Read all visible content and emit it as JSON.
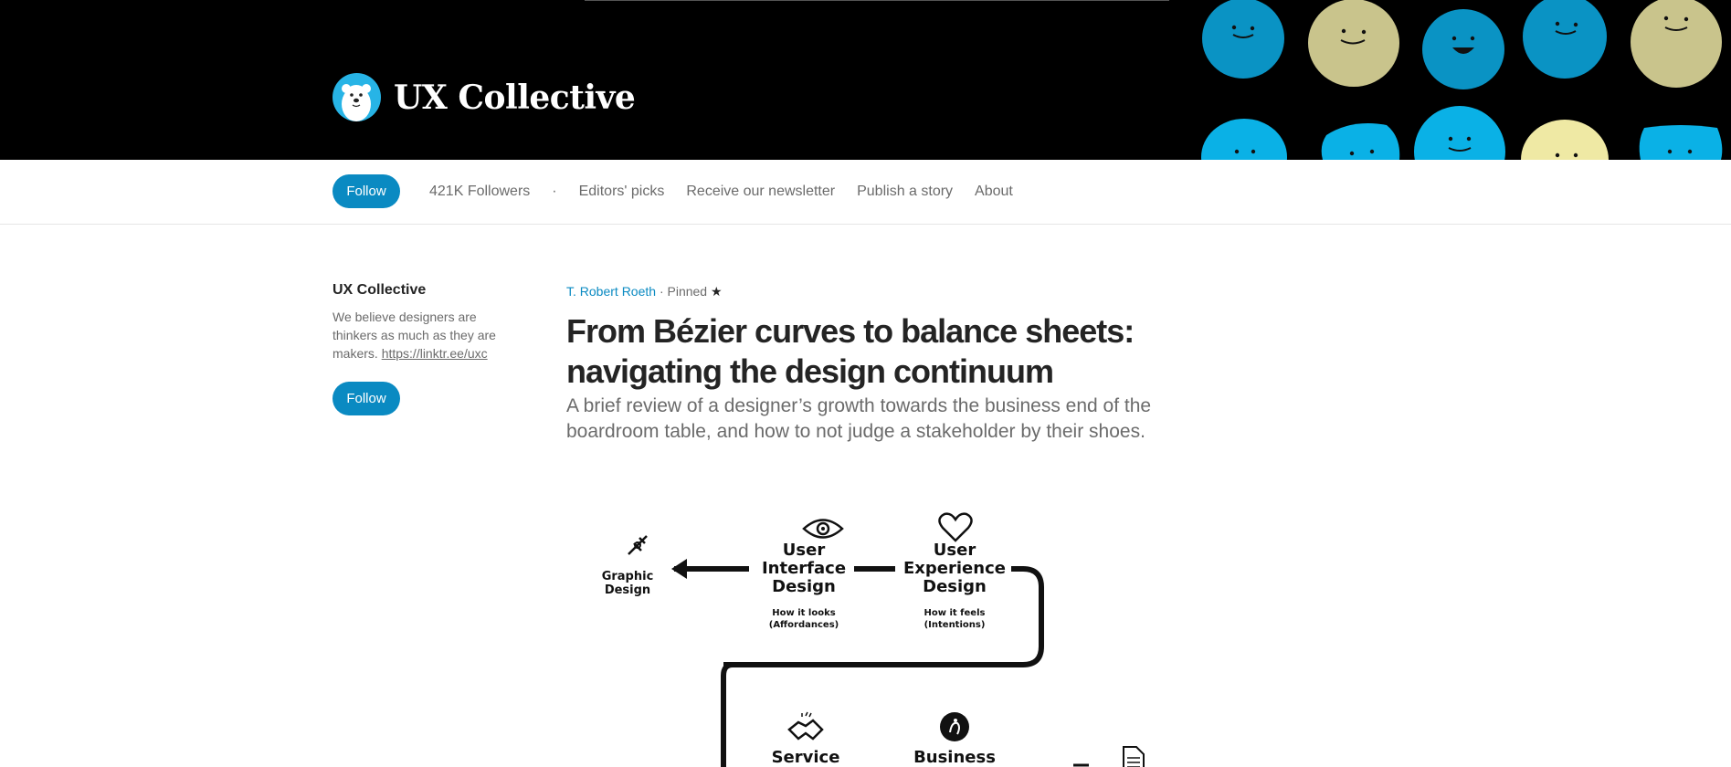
{
  "publication": {
    "name": "UX Collective",
    "logo_icon": "polar-bear-logo",
    "banner_icon": "smiley-faces-pattern"
  },
  "nav": {
    "follow_label": "Follow",
    "followers": "421K Followers",
    "separator": "·",
    "items": [
      "Editors' picks",
      "Receive our newsletter",
      "Publish a story",
      "About"
    ]
  },
  "sidebar": {
    "title": "UX Collective",
    "description": "We believe designers are thinkers as much as they are makers.",
    "link": "https://linktr.ee/uxc",
    "follow_label": "Follow"
  },
  "article": {
    "author": "T. Robert Roeth",
    "pinned": "· Pinned",
    "pinned_icon": "star-icon",
    "title": "From Bézier curves to balance sheets: navigating the design continuum",
    "subtitle": "A brief review of a designer’s growth towards the business end of the boardroom table, and how to not judge a stakeholder by their shoes."
  },
  "diagram": {
    "graphic_design": [
      "Graphic",
      "Design"
    ],
    "ui_design": [
      "User",
      "Interface",
      "Design"
    ],
    "ui_sub": [
      "How it looks",
      "(Affordances)"
    ],
    "ux_design": [
      "User",
      "Experience",
      "Design"
    ],
    "ux_sub": [
      "How it feels",
      "(Intentions)"
    ],
    "service": "Service",
    "business": "Business",
    "icons": [
      "pen-tool-icon",
      "eye-icon",
      "heart-icon",
      "handshake-icon",
      "head-icon",
      "document-icon"
    ]
  },
  "colors": {
    "accent": "#0a8ac2",
    "banner_bg": "#000000",
    "text": "#242424",
    "muted": "#6b6b6b",
    "face_blue": "#0ab1e6",
    "face_dark_blue": "#0a93c4",
    "face_olive": "#c9c48c",
    "face_yellow": "#efe9a4"
  }
}
